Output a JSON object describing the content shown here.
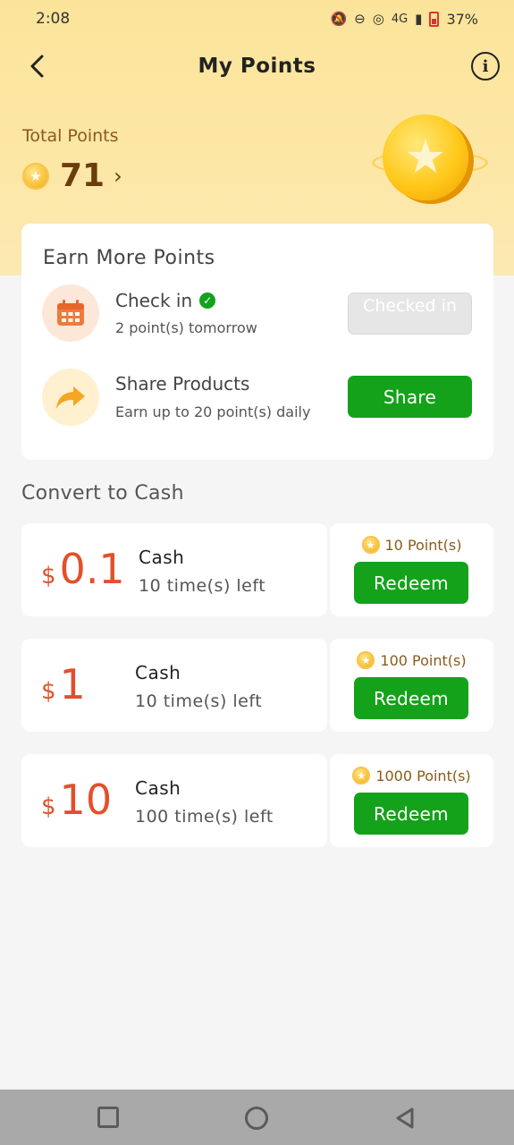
{
  "status": {
    "time": "2:08",
    "network": "4G",
    "battery": "37%"
  },
  "header": {
    "title": "My Points"
  },
  "points": {
    "label": "Total Points",
    "value": "71"
  },
  "earn": {
    "title": "Earn More Points",
    "tasks": [
      {
        "name": "Check in",
        "sub": "2 point(s) tomorrow",
        "button": "Checked in",
        "enabled": false
      },
      {
        "name": "Share Products",
        "sub": "Earn up to 20 point(s) daily",
        "button": "Share",
        "enabled": true
      }
    ]
  },
  "convert": {
    "title": "Convert to Cash",
    "items": [
      {
        "currency": "$",
        "amount": "0.1",
        "name": "Cash",
        "times": "10 time(s) left",
        "cost": "10 Point(s)",
        "button": "Redeem"
      },
      {
        "currency": "$",
        "amount": "1",
        "name": "Cash",
        "times": "10 time(s) left",
        "cost": "100 Point(s)",
        "button": "Redeem"
      },
      {
        "currency": "$",
        "amount": "10",
        "name": "Cash",
        "times": "100 time(s) left",
        "cost": "1000 Point(s)",
        "button": "Redeem"
      }
    ]
  },
  "colors": {
    "accent": "#14a21a",
    "amount": "#e2502b",
    "hero": "#fde7a6",
    "points": "#6b3d0c"
  }
}
